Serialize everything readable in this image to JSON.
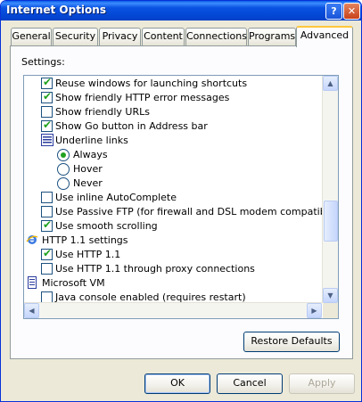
{
  "window": {
    "title": "Internet Options",
    "help_glyph": "?",
    "close_glyph": "✕"
  },
  "tabs": [
    {
      "label": "General"
    },
    {
      "label": "Security"
    },
    {
      "label": "Privacy"
    },
    {
      "label": "Content"
    },
    {
      "label": "Connections"
    },
    {
      "label": "Programs"
    },
    {
      "label": "Advanced",
      "active": true
    }
  ],
  "settings": {
    "label": "Settings:",
    "items": [
      {
        "label": "Reuse windows for launching shortcuts",
        "kind": "checkbox",
        "checked": true
      },
      {
        "label": "Show friendly HTTP error messages",
        "kind": "checkbox",
        "checked": true
      },
      {
        "label": "Show friendly URLs",
        "kind": "checkbox",
        "checked": false
      },
      {
        "label": "Show Go button in Address bar",
        "kind": "checkbox",
        "checked": true
      },
      {
        "label": "Underline links",
        "kind": "group",
        "icon": "list-settings-icon"
      },
      {
        "label": "Always",
        "kind": "radio",
        "checked": true
      },
      {
        "label": "Hover",
        "kind": "radio",
        "checked": false
      },
      {
        "label": "Never",
        "kind": "radio",
        "checked": false
      },
      {
        "label": "Use inline AutoComplete",
        "kind": "checkbox",
        "checked": false
      },
      {
        "label": "Use Passive FTP (for firewall and DSL modem compatibility)",
        "kind": "checkbox",
        "checked": false
      },
      {
        "label": "Use smooth scrolling",
        "kind": "checkbox",
        "checked": true
      },
      {
        "label": "HTTP 1.1 settings",
        "kind": "group",
        "icon": "ie-icon"
      },
      {
        "label": "Use HTTP 1.1",
        "kind": "checkbox",
        "checked": true
      },
      {
        "label": "Use HTTP 1.1 through proxy connections",
        "kind": "checkbox",
        "checked": false
      },
      {
        "label": "Microsoft VM",
        "kind": "group",
        "icon": "document-icon"
      },
      {
        "label": "Java console enabled (requires restart)",
        "kind": "checkbox",
        "checked": false
      }
    ]
  },
  "buttons": {
    "restore_defaults": "Restore Defaults",
    "ok": "OK",
    "cancel": "Cancel",
    "apply": "Apply"
  },
  "colors": {
    "titlebar": "#0a53e2",
    "dialog_bg": "#ece9d8",
    "check_green": "#21a121",
    "tab_highlight": "#ffc73c"
  }
}
